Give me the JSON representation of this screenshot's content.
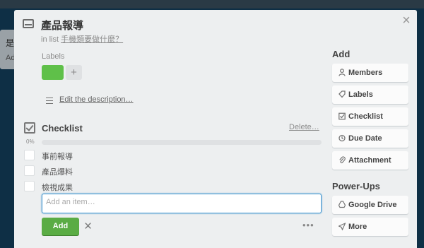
{
  "background": {
    "card_text_1": "是",
    "card_text_2": "Ad"
  },
  "card": {
    "title": "產品報導",
    "in_list_prefix": "in list",
    "list_name": "手機類要做什麼？",
    "labels_heading": "Labels",
    "label_color": "#5fc049",
    "add_label_symbol": "+",
    "edit_description": "Edit the description…"
  },
  "checklist": {
    "title": "Checklist",
    "delete_label": "Delete…",
    "progress_text": "0%",
    "progress_value": 0,
    "items": [
      {
        "text": "事前報導",
        "checked": false
      },
      {
        "text": "產品爆料",
        "checked": false
      },
      {
        "text": "檢視成果",
        "checked": false
      }
    ],
    "input_placeholder": "Add an item…",
    "add_button": "Add",
    "cancel_symbol": "×",
    "more_symbol": "•••"
  },
  "sidebar": {
    "add_heading": "Add",
    "add_buttons": [
      {
        "label": "Members",
        "icon": "person-icon"
      },
      {
        "label": "Labels",
        "icon": "tag-icon"
      },
      {
        "label": "Checklist",
        "icon": "checkbox-icon"
      },
      {
        "label": "Due Date",
        "icon": "clock-icon"
      },
      {
        "label": "Attachment",
        "icon": "paperclip-icon"
      }
    ],
    "powerups_heading": "Power-Ups",
    "powerup_buttons": [
      {
        "label": "Google Drive",
        "icon": "google-drive-icon"
      },
      {
        "label": "More",
        "icon": "send-icon"
      }
    ]
  },
  "close_symbol": "×",
  "colors": {
    "accent_green": "#5aac44",
    "input_focus": "#4b9bd1",
    "backdrop": "#0e2f45"
  }
}
